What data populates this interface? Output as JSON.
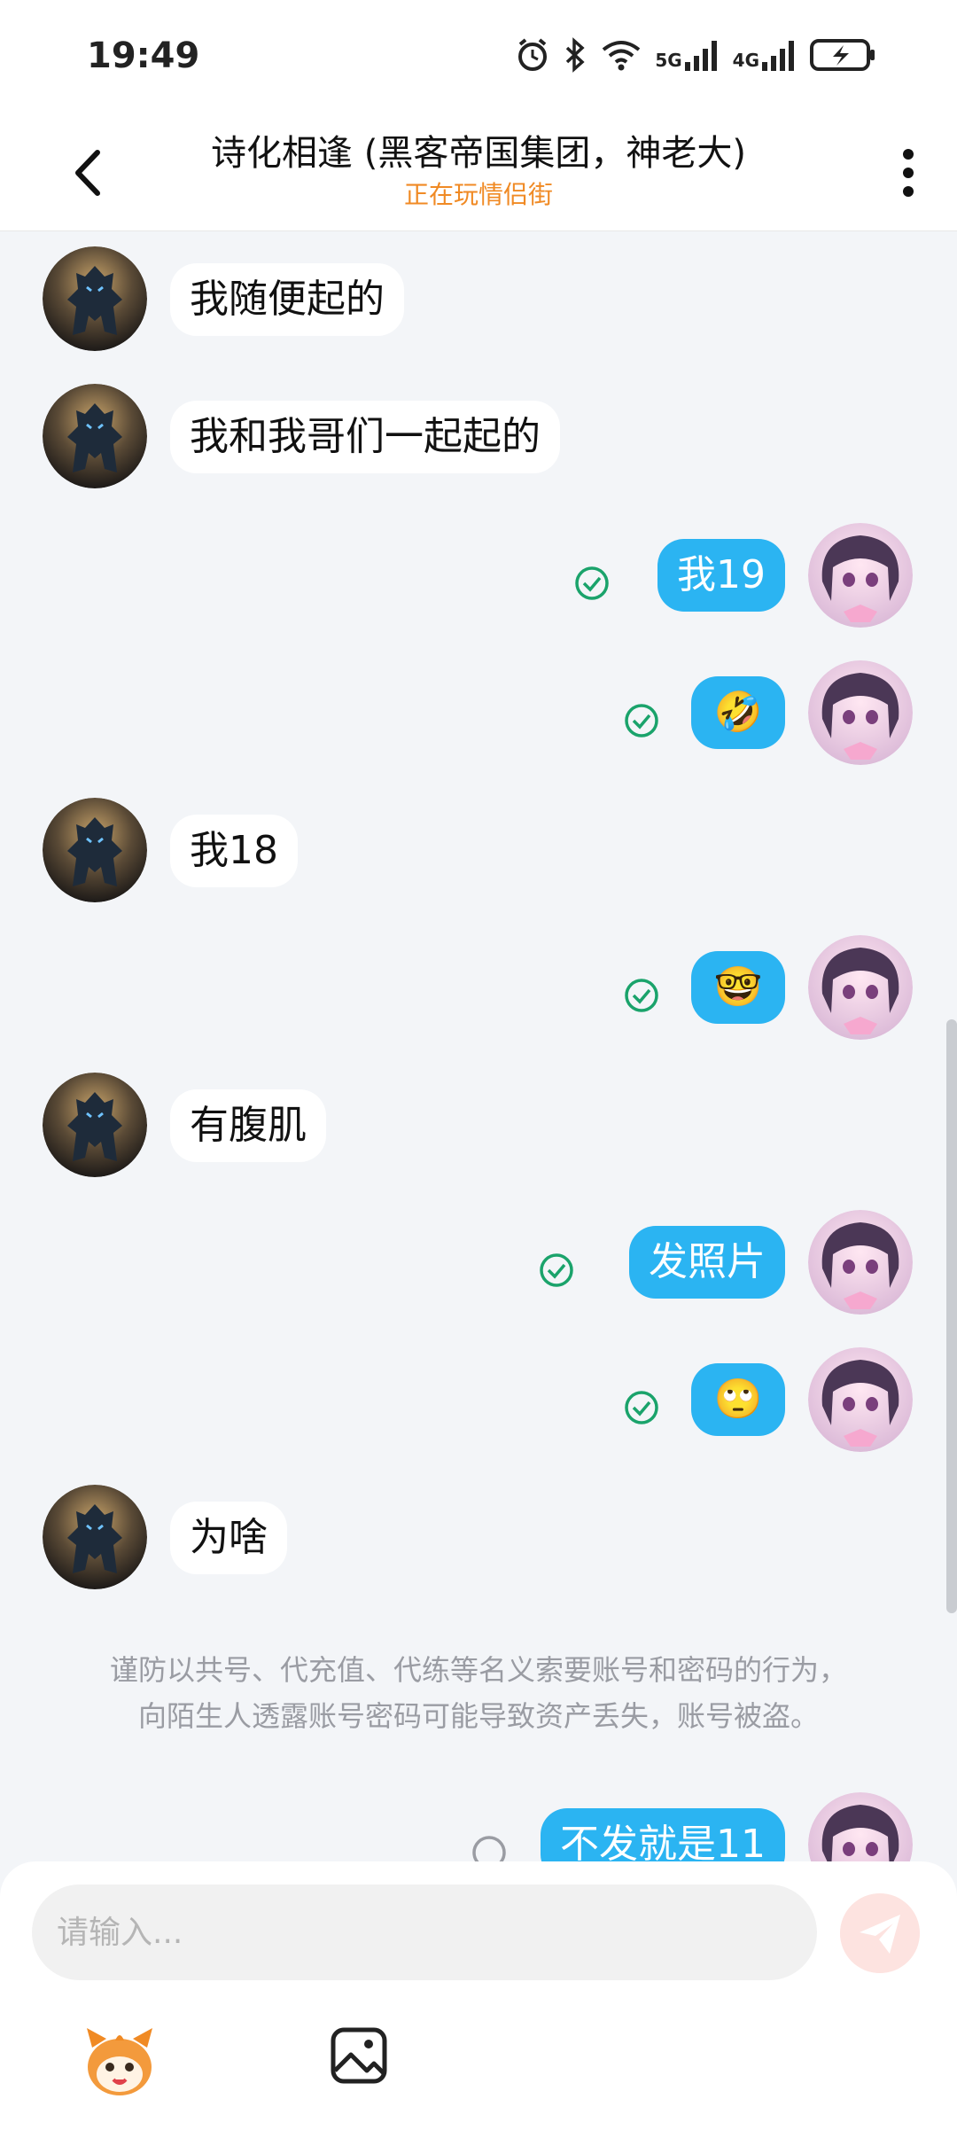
{
  "status_bar": {
    "time": "19:49",
    "net1": "5G",
    "net2": "4G"
  },
  "header": {
    "title": "诗化相逢 (黑客帝国集团，神老大)",
    "subtitle": "正在玩情侣街"
  },
  "messages": [
    {
      "side": "in",
      "text": "我随便起的"
    },
    {
      "side": "in",
      "text": "我和我哥们一起起的"
    },
    {
      "side": "out",
      "text": "我19",
      "status": "read"
    },
    {
      "side": "out",
      "text": "🤣",
      "status": "read"
    },
    {
      "side": "in",
      "text": "我18"
    },
    {
      "side": "out",
      "text": "🤓",
      "status": "read"
    },
    {
      "side": "in",
      "text": "有腹肌"
    },
    {
      "side": "out",
      "text": "发照片",
      "status": "read"
    },
    {
      "side": "out",
      "text": "🙄",
      "status": "read"
    },
    {
      "side": "in",
      "text": "为啥"
    },
    {
      "side": "out",
      "text": "不发就是11",
      "status": "sending"
    }
  ],
  "notice": {
    "line1": "谨防以共号、代充值、代练等名义索要账号和密码的行为，",
    "line2": "向陌生人透露账号密码可能导致资产丢失，账号被盗。"
  },
  "input": {
    "placeholder": "请输入..."
  },
  "icons": {
    "back": "chevron-left-icon",
    "more": "more-vertical-icon",
    "send": "send-icon",
    "emoji": "emoji-mascot-icon",
    "image": "image-icon"
  },
  "colors": {
    "outgoing_bubble": "#2bb4f2",
    "subtitle": "#f08a24",
    "read_check": "#1aa36b",
    "send_button": "#fde3e0"
  }
}
